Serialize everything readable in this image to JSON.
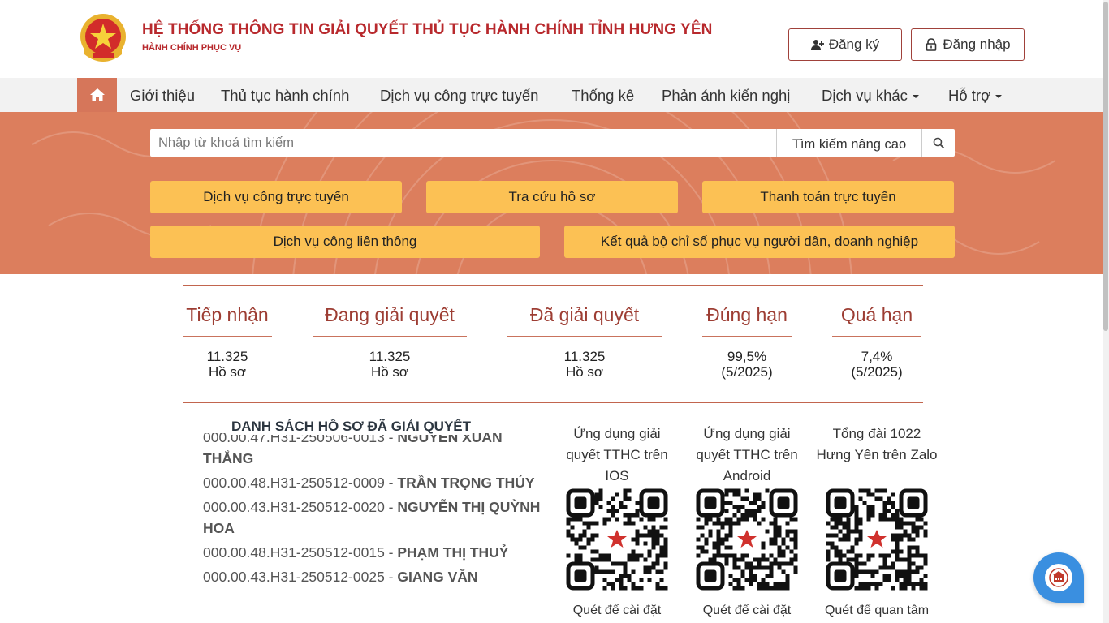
{
  "header": {
    "title": "HỆ THỐNG THÔNG TIN GIẢI QUYẾT THỦ TỤC HÀNH CHÍNH TỈNH HƯNG YÊN",
    "subtitle": "HÀNH CHÍNH PHỤC VỤ",
    "register_label": "Đăng ký",
    "login_label": "Đăng nhập"
  },
  "nav": {
    "items": [
      {
        "label": "Giới thiệu",
        "dropdown": false
      },
      {
        "label": "Thủ tục hành chính",
        "dropdown": false
      },
      {
        "label": "Dịch vụ công trực tuyến",
        "dropdown": false
      },
      {
        "label": "Thống kê",
        "dropdown": false
      },
      {
        "label": "Phản ánh kiến nghị",
        "dropdown": false
      },
      {
        "label": "Dịch vụ khác",
        "dropdown": true
      },
      {
        "label": "Hỗ trợ",
        "dropdown": true
      }
    ]
  },
  "search": {
    "placeholder": "Nhập từ khoá tìm kiếm",
    "advanced_label": "Tìm kiếm nâng cao"
  },
  "quick_links": [
    "Dịch vụ công trực tuyến",
    "Tra cứu hồ sơ",
    "Thanh toán trực tuyến",
    "Dịch vụ công liên thông",
    "Kết quả bộ chỉ số phục vụ người dân, doanh nghiệp"
  ],
  "stats": [
    {
      "label": "Tiếp nhận",
      "value": "11.325",
      "unit": "Hồ sơ"
    },
    {
      "label": "Đang giải quyết",
      "value": "11.325",
      "unit": "Hồ sơ"
    },
    {
      "label": "Đã giải quyết",
      "value": "11.325",
      "unit": "Hồ sơ"
    },
    {
      "label": "Đúng hạn",
      "value": "99,5%",
      "unit": "(5/2025)"
    },
    {
      "label": "Quá hạn",
      "value": "7,4%",
      "unit": "(5/2025)"
    }
  ],
  "resolved_list": {
    "title": "DANH SÁCH HỒ SƠ ĐÃ GIẢI QUYẾT",
    "items": [
      {
        "code": "000.00.47.H31-250506-0013",
        "name": "NGUYỄN XUÂN THẮNG"
      },
      {
        "code": "000.00.48.H31-250512-0009",
        "name": "TRẦN TRỌNG THỦY"
      },
      {
        "code": "000.00.43.H31-250512-0020",
        "name": "NGUYỄN THỊ QUỲNH HOA"
      },
      {
        "code": "000.00.48.H31-250512-0015",
        "name": "PHẠM THỊ THUỶ"
      },
      {
        "code": "000.00.43.H31-250512-0025",
        "name": "GIANG VĂN"
      }
    ]
  },
  "qr_codes": [
    {
      "caption": "Ứng dụng giải quyết TTHC trên IOS",
      "footer": "Quét để cài đặt"
    },
    {
      "caption": "Ứng dụng giải quyết TTHC trên Android",
      "footer": "Quét để cài đặt"
    },
    {
      "caption": "Tổng đài 1022 Hưng Yên trên Zalo",
      "footer": "Quét để quan tâm"
    }
  ],
  "colors": {
    "brand_red": "#b8292d",
    "banner": "#dc7e5d",
    "quick_button": "#fcc154",
    "stat_label": "#9d3d33",
    "chat_button": "#3a8fe0"
  },
  "icons": {
    "emblem": "national-emblem-icon",
    "register": "user-plus-icon",
    "login": "lock-icon",
    "home": "home-icon",
    "search": "search-icon",
    "chat": "chat-assistant-icon"
  }
}
